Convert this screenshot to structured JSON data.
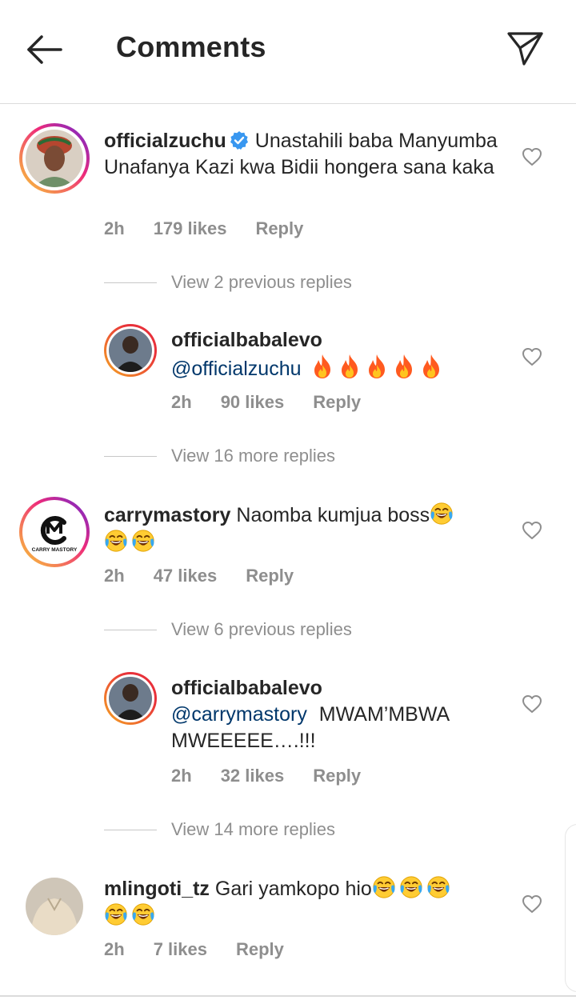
{
  "header": {
    "title": "Comments",
    "back_icon": "arrow-left-icon",
    "share_icon": "paper-plane-icon"
  },
  "comments": [
    {
      "username": "officialzuchu",
      "verified": true,
      "text": "Unastahili baba Manyumba Unafanya Kazi kwa Bidii hongera sana kaka",
      "time": "2h",
      "likes": "179 likes",
      "reply_label": "Reply",
      "view_previous": "View 2 previous replies",
      "reply": {
        "username": "officialbabalevo",
        "mention": "@officialzuchu",
        "emoji": [
          "fire",
          "fire",
          "fire",
          "fire",
          "fire"
        ],
        "time": "2h",
        "likes": "90 likes",
        "reply_label": "Reply"
      },
      "view_more": "View 16 more replies"
    },
    {
      "username": "carrymastory",
      "avatar_text": "CARRY MASTORY",
      "text": "Naomba kumjua boss",
      "emoji": [
        "face-with-tears-of-joy",
        "face-with-tears-of-joy",
        "face-with-tears-of-joy"
      ],
      "time": "2h",
      "likes": "47 likes",
      "reply_label": "Reply",
      "view_previous": "View 6 previous replies",
      "reply": {
        "username": "officialbabalevo",
        "mention": "@carrymastory",
        "text": "MWAM’MBWA MWEEEEE….!!!",
        "time": "2h",
        "likes": "32 likes",
        "reply_label": "Reply"
      },
      "view_more": "View 14 more replies"
    },
    {
      "username": "mlingoti_tz",
      "text": "Gari yamkopo hio",
      "emoji": [
        "face-with-tears-of-joy",
        "face-with-tears-of-joy",
        "face-with-tears-of-joy",
        "face-with-tears-of-joy",
        "face-with-tears-of-joy"
      ],
      "time": "2h",
      "likes": "7 likes",
      "reply_label": "Reply"
    }
  ],
  "colors": {
    "text": "#262626",
    "meta": "#8e8e8e",
    "mention": "#00376b",
    "verified": "#3897f0",
    "divider": "#dbdbdb"
  }
}
